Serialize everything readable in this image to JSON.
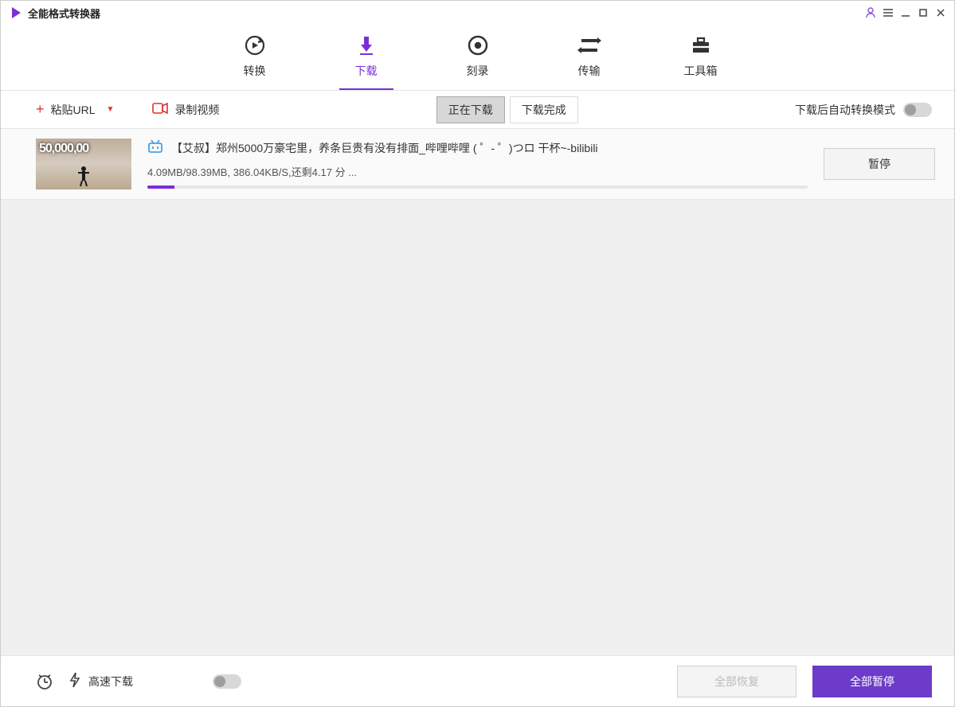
{
  "app": {
    "title": "全能格式转换器"
  },
  "nav": {
    "tabs": [
      {
        "label": "转换"
      },
      {
        "label": "下载"
      },
      {
        "label": "刻录"
      },
      {
        "label": "传输"
      },
      {
        "label": "工具箱"
      }
    ]
  },
  "toolbar": {
    "paste_label": "粘贴URL",
    "record_label": "录制视频",
    "subtab_downloading": "正在下载",
    "subtab_completed": "下载完成",
    "auto_convert_label": "下载后自动转换模式"
  },
  "downloads": [
    {
      "title": "【艾叔】郑州5000万豪宅里，养条巨贵有没有排面_哔哩哔哩 ( ゜- ゜)つロ  干杯~-bilibili",
      "status": "4.09MB/98.39MB, 386.04KB/S,还剩4.17 分 ...",
      "progress_percent": 4.1,
      "thumb_overlay": "50,000,00",
      "action_label": "暂停"
    }
  ],
  "footer": {
    "fast_download_label": "高速下载",
    "resume_all_label": "全部恢复",
    "pause_all_label": "全部暂停"
  }
}
